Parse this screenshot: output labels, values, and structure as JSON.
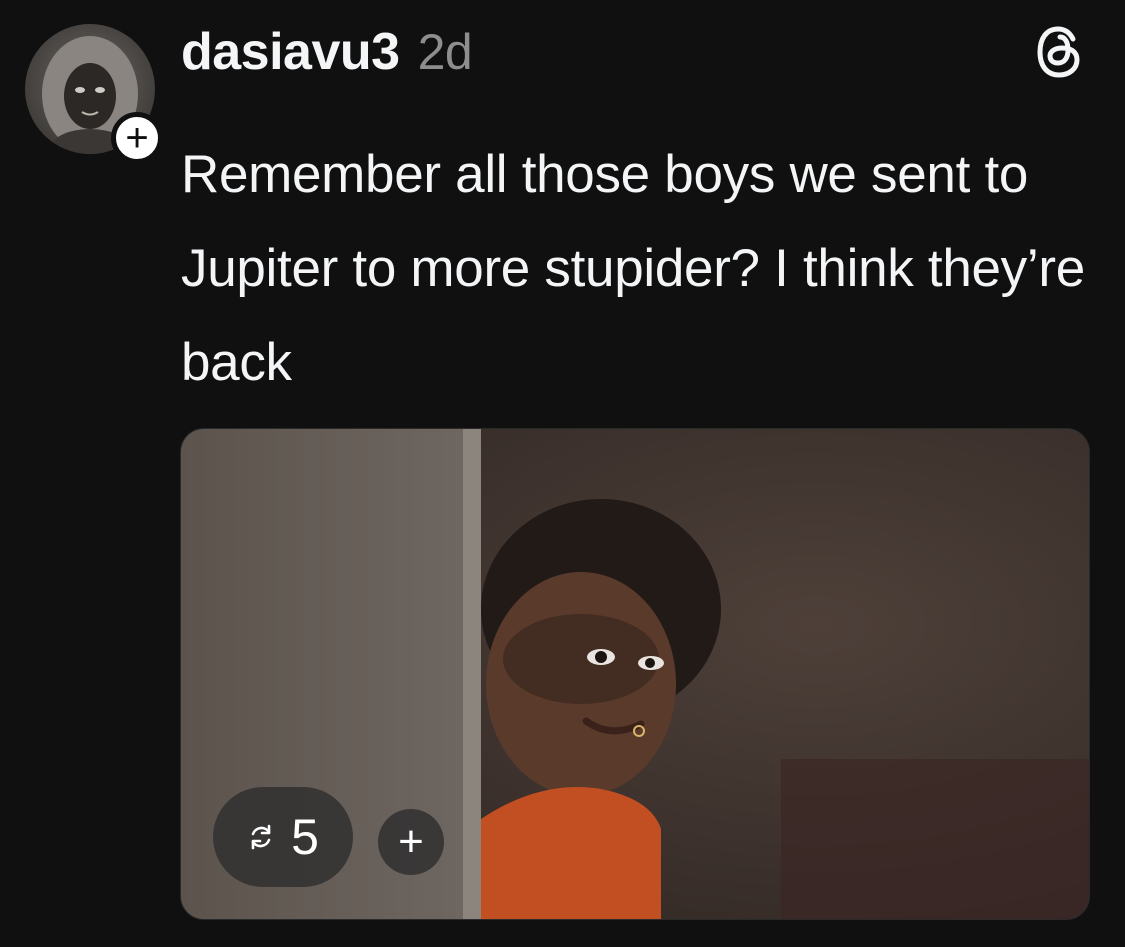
{
  "post": {
    "username": "dasiavu3",
    "time": "2d",
    "text": "Remember all those boys we sent to Jupiter to more stupider? I think they’re back",
    "follow_symbol": "+",
    "media": {
      "repost_count": "5",
      "add_symbol": "+"
    }
  },
  "icons": {
    "app_logo": "threads-logo-icon",
    "repost": "repost-icon",
    "avatar": "avatar"
  },
  "colors": {
    "background": "#101010",
    "text_primary": "#f3f5f7",
    "text_secondary": "#8e8e8e"
  }
}
